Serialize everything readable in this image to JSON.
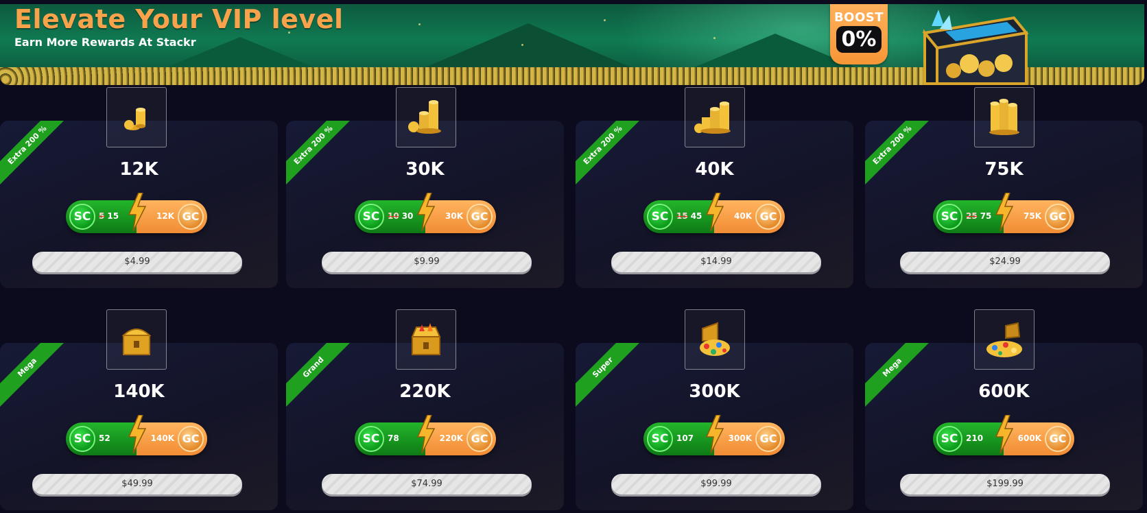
{
  "banner": {
    "title": "Elevate Your VIP level",
    "subtitle": "Earn More Rewards At Stackr",
    "boost_label": "BOOST",
    "boost_value": "0%"
  },
  "colors": {
    "background": "#0c0b1d",
    "title_orange": "#f8a24b",
    "sc_green": "#1fa11f",
    "gc_orange": "#f69637",
    "ribbon_green": "#1fa11f"
  },
  "packages": [
    {
      "ribbon": "Extra 200 %",
      "icon": "small-coin-stack-icon",
      "amount": "12K",
      "sc_label": "SC",
      "sc_old": "5",
      "sc_value": "15",
      "gc_value": "12K",
      "gc_label": "GC",
      "price": "$4.99"
    },
    {
      "ribbon": "Extra 200 %",
      "icon": "coin-stacks-icon",
      "amount": "30K",
      "sc_label": "SC",
      "sc_old": "10",
      "sc_value": "30",
      "gc_value": "30K",
      "gc_label": "GC",
      "price": "$9.99"
    },
    {
      "ribbon": "Extra 200 %",
      "icon": "coin-stacks-icon",
      "amount": "40K",
      "sc_label": "SC",
      "sc_old": "15",
      "sc_value": "45",
      "gc_value": "40K",
      "gc_label": "GC",
      "price": "$14.99"
    },
    {
      "ribbon": "Extra 200 %",
      "icon": "large-coin-stacks-icon",
      "amount": "75K",
      "sc_label": "SC",
      "sc_old": "25",
      "sc_value": "75",
      "gc_value": "75K",
      "gc_label": "GC",
      "price": "$24.99"
    },
    {
      "ribbon": "Mega",
      "icon": "gold-chest-icon",
      "amount": "140K",
      "sc_label": "SC",
      "sc_old": "",
      "sc_value": "52",
      "gc_value": "140K",
      "gc_label": "GC",
      "price": "$49.99"
    },
    {
      "ribbon": "Grand",
      "icon": "jewel-chest-icon",
      "amount": "220K",
      "sc_label": "SC",
      "sc_old": "",
      "sc_value": "78",
      "gc_value": "220K",
      "gc_label": "GC",
      "price": "$74.99"
    },
    {
      "ribbon": "Super",
      "icon": "treasure-chest-icon",
      "amount": "300K",
      "sc_label": "SC",
      "sc_old": "",
      "sc_value": "107",
      "gc_value": "300K",
      "gc_label": "GC",
      "price": "$99.99"
    },
    {
      "ribbon": "Mega",
      "icon": "treasure-hoard-icon",
      "amount": "600K",
      "sc_label": "SC",
      "sc_old": "",
      "sc_value": "210",
      "gc_value": "600K",
      "gc_label": "GC",
      "price": "$199.99"
    }
  ]
}
